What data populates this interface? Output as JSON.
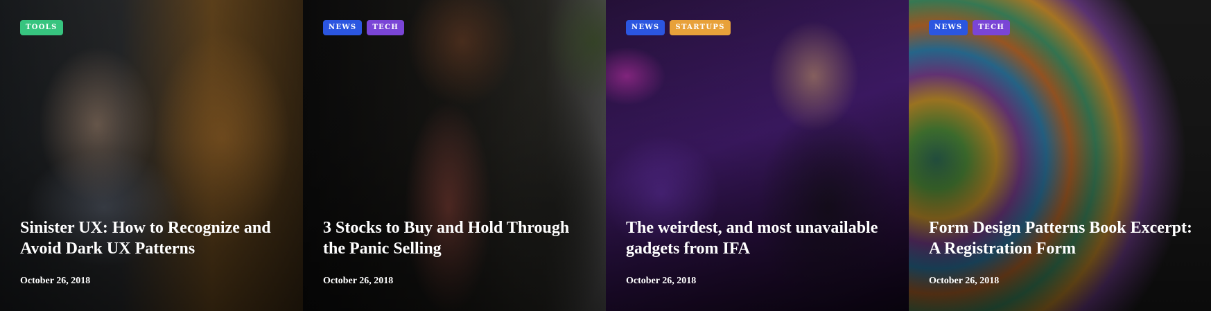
{
  "colors": {
    "tag_tools": "#37c47f",
    "tag_news": "#2b56e0",
    "tag_tech": "#7a45d6",
    "tag_startups": "#e8a13a"
  },
  "cards": [
    {
      "tags": [
        {
          "label": "TOOLS",
          "color": "#37c47f"
        }
      ],
      "title": "Sinister UX: How to Recognize and Avoid Dark UX Patterns",
      "date": "October 26, 2018"
    },
    {
      "tags": [
        {
          "label": "NEWS",
          "color": "#2b56e0"
        },
        {
          "label": "TECH",
          "color": "#7a45d6"
        }
      ],
      "title": "3 Stocks to Buy and Hold Through the Panic Selling",
      "date": "October 26, 2018"
    },
    {
      "tags": [
        {
          "label": "NEWS",
          "color": "#2b56e0"
        },
        {
          "label": "STARTUPS",
          "color": "#e8a13a"
        }
      ],
      "title": "The weirdest, and most unavailable gadgets from IFA",
      "date": "October 26, 2018"
    },
    {
      "tags": [
        {
          "label": "NEWS",
          "color": "#2b56e0"
        },
        {
          "label": "TECH",
          "color": "#7a45d6"
        }
      ],
      "title": "Form Design Patterns Book Excerpt: A Registration Form",
      "date": "October 26, 2018"
    }
  ]
}
